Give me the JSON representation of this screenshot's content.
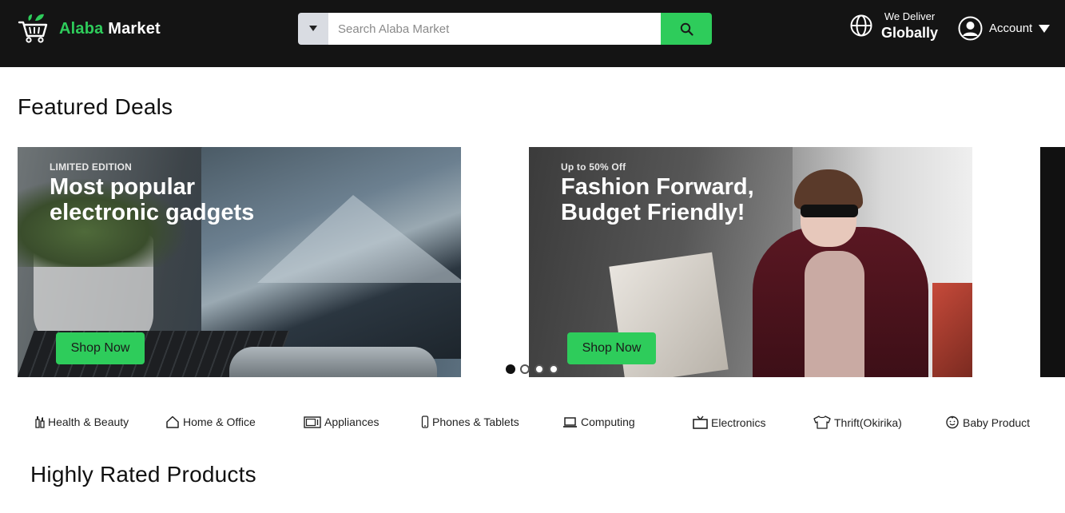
{
  "header": {
    "logo_part1": "Alaba",
    "logo_part2": "Market",
    "search_placeholder": "Search Alaba Market",
    "deliver_small": "We Deliver",
    "deliver_big": "Globally",
    "account_label": "Account"
  },
  "featured": {
    "title": "Featured Deals",
    "banners": [
      {
        "kicker": "LIMITED EDITION",
        "headline_line1": "Most popular",
        "headline_line2": "electronic gadgets",
        "button": "Shop Now"
      },
      {
        "kicker": "Up to 50% Off",
        "headline_line1": "Fashion Forward,",
        "headline_line2": "Budget Friendly!",
        "button": "Shop Now"
      }
    ],
    "carousel_pages": 4,
    "carousel_active": 1
  },
  "categories": [
    {
      "label": "Health & Beauty",
      "icon": "beauty-icon"
    },
    {
      "label": "Home & Office",
      "icon": "home-icon"
    },
    {
      "label": "Appliances",
      "icon": "appliance-icon"
    },
    {
      "label": "Phones & Tablets",
      "icon": "phone-icon"
    },
    {
      "label": "Computing",
      "icon": "laptop-icon"
    },
    {
      "label": "Electronics",
      "icon": "tv-icon"
    },
    {
      "label": "Thrift(Okirika)",
      "icon": "shirt-icon"
    },
    {
      "label": "Baby Product",
      "icon": "baby-icon"
    }
  ],
  "rated": {
    "title": "Highly Rated Products"
  },
  "colors": {
    "brand_green": "#2ecc5b",
    "header_bg": "#141414"
  }
}
